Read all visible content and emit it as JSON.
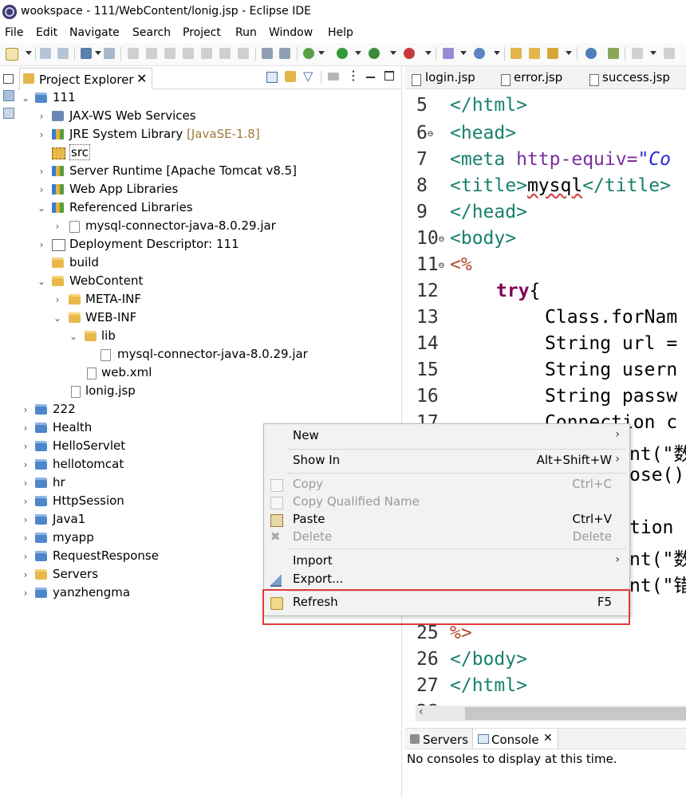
{
  "window": {
    "title": "wookspace - 111/WebContent/lonig.jsp - Eclipse IDE"
  },
  "menubar": [
    "File",
    "Edit",
    "Navigate",
    "Search",
    "Project",
    "Run",
    "Window",
    "Help"
  ],
  "project_explorer": {
    "title": "Project Explorer",
    "tree": [
      {
        "label": "111",
        "expanded": true
      },
      {
        "label": "JAX-WS Web Services"
      },
      {
        "label": "JRE System Library",
        "suffix": "[JavaSE-1.8]"
      },
      {
        "label": "src"
      },
      {
        "label": "Server Runtime [Apache Tomcat v8.5]"
      },
      {
        "label": "Web App Libraries"
      },
      {
        "label": "Referenced Libraries",
        "expanded": true
      },
      {
        "label": "mysql-connector-java-8.0.29.jar"
      },
      {
        "label": "Deployment Descriptor: 111"
      },
      {
        "label": "build"
      },
      {
        "label": "WebContent",
        "expanded": true
      },
      {
        "label": "META-INF"
      },
      {
        "label": "WEB-INF",
        "expanded": true
      },
      {
        "label": "lib",
        "expanded": true
      },
      {
        "label": "mysql-connector-java-8.0.29.jar"
      },
      {
        "label": "web.xml"
      },
      {
        "label": "lonig.jsp"
      },
      {
        "label": "222"
      },
      {
        "label": "Health"
      },
      {
        "label": "HelloServlet"
      },
      {
        "label": "hellotomcat"
      },
      {
        "label": "hr"
      },
      {
        "label": "HttpSession"
      },
      {
        "label": "Java1"
      },
      {
        "label": "myapp"
      },
      {
        "label": "RequestResponse"
      },
      {
        "label": "Servers"
      },
      {
        "label": "yanzhengma"
      }
    ]
  },
  "editor": {
    "tabs": [
      "login.jsp",
      "error.jsp",
      "success.jsp"
    ],
    "lines": [
      {
        "n": "6",
        "marker": "⊖",
        "html": "head"
      },
      {
        "n": "7",
        "marker": "",
        "html": "meta"
      },
      {
        "n": "8",
        "marker": "",
        "html": "title"
      },
      {
        "n": "9",
        "marker": "",
        "html": "endhead"
      },
      {
        "n": "10",
        "marker": "⊖",
        "html": "body"
      },
      {
        "n": "11",
        "marker": "⊖",
        "html": "pct"
      },
      {
        "n": "12",
        "marker": "",
        "html": "try"
      },
      {
        "n": "13",
        "marker": "",
        "html": "cls"
      },
      {
        "n": "14",
        "marker": "",
        "html": "url"
      },
      {
        "n": "15",
        "marker": "",
        "html": "user"
      },
      {
        "n": "16",
        "marker": "",
        "html": "pass"
      },
      {
        "n": "17",
        "marker": "",
        "html": "conn"
      }
    ],
    "line_3_partial": "</html>",
    "head_text": "<head>",
    "meta_tag": "<meta",
    "meta_attr": "http-equiv=",
    "meta_value": "\"Co",
    "title_open": "<title>",
    "title_text": "mysql",
    "title_close": "</title>",
    "endhead": "</head>",
    "body_open": "<body>",
    "pct_open": "<%",
    "try_text": "try",
    "try_brace": "{",
    "class_for": "Class.forNam",
    "url_line": "String url =",
    "user_line": "String usern",
    "pass_line": "String passw",
    "conn_line": "Connection c",
    "peek_18": "nt(\"数",
    "peek_19": "ose()",
    "peek_21": "tion",
    "peek_22": "nt(\"数",
    "peek_23": "nt(\"错",
    "line_25_n": "25",
    "line_25_code": "%>",
    "line_26_n": "26",
    "line_26_code": "</body>",
    "line_27_n": "27",
    "line_27_code": "</html>",
    "line_28_n": "28"
  },
  "console": {
    "tabs": [
      "Servers",
      "Console"
    ],
    "message": "No consoles to display at this time."
  },
  "context_menu": {
    "items": [
      {
        "label": "New",
        "submenu": true
      },
      {
        "label": "Show In",
        "accel": "Alt+Shift+W",
        "submenu": true
      },
      {
        "label": "Copy",
        "accel": "Ctrl+C",
        "disabled": true
      },
      {
        "label": "Copy Qualified Name",
        "disabled": true
      },
      {
        "label": "Paste",
        "accel": "Ctrl+V"
      },
      {
        "label": "Delete",
        "accel": "Delete",
        "disabled": true
      },
      {
        "label": "Import",
        "submenu": true
      },
      {
        "label": "Export..."
      },
      {
        "label": "Refresh",
        "accel": "F5"
      }
    ]
  },
  "colors": {
    "highlight": "#e23a3a",
    "tag": "#17806d",
    "keyword": "#7f0055"
  }
}
